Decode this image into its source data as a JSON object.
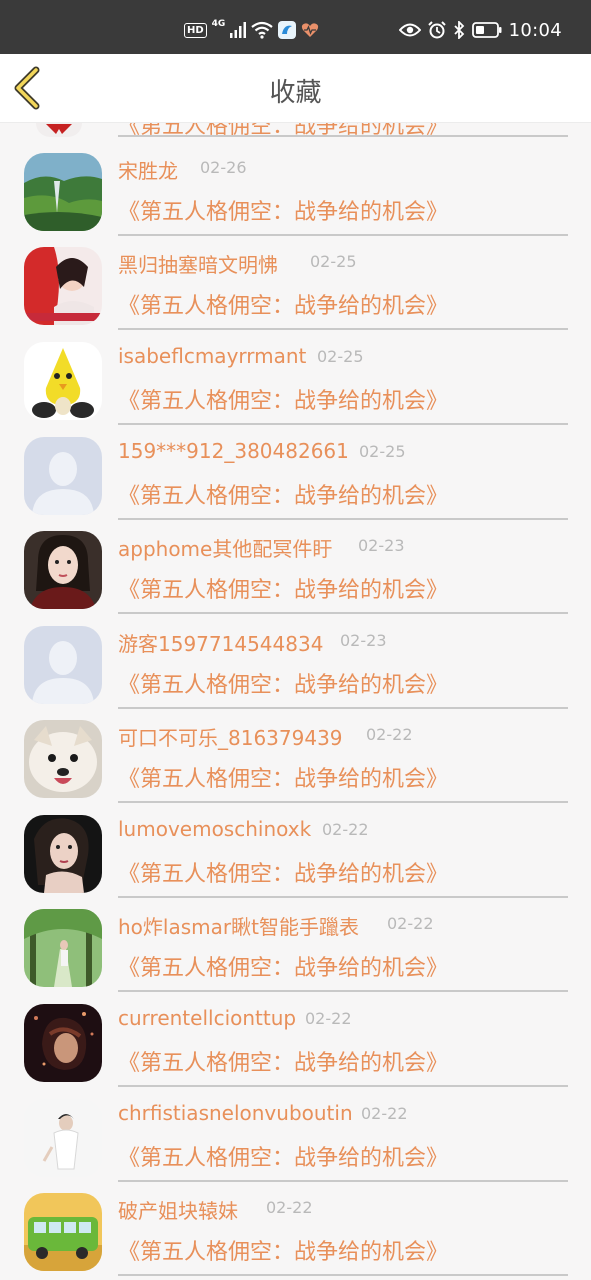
{
  "status_bar": {
    "hd": "HD",
    "network": "4G",
    "time": "10:04"
  },
  "header": {
    "title": "收藏",
    "back_icon": "chevron-left-icon"
  },
  "accent_color": "#e8905a",
  "partial_entry": {
    "book": "《第五人格佣空：战争给的机会》"
  },
  "entries": [
    {
      "name": "宋胜龙",
      "date": "02-26",
      "book": "《第五人格佣空：战争给的机会》",
      "avatar": "landscape-photo"
    },
    {
      "name": "黑归抽塞暗文明怫",
      "date": "02-25",
      "book": "《第五人格佣空：战争给的机会》",
      "avatar": "portrait-red-photo"
    },
    {
      "name": "isabeflcmayrrmant",
      "date": "02-25",
      "book": "《第五人格佣空：战争给的机会》",
      "avatar": "yellow-toy-photo"
    },
    {
      "name": "159***912_380482661",
      "date": "02-25",
      "book": "《第五人格佣空：战争给的机会》",
      "avatar": "default-person"
    },
    {
      "name": "apphome其他配冥件盱",
      "date": "02-23",
      "book": "《第五人格佣空：战争给的机会》",
      "avatar": "portrait-dark-photo"
    },
    {
      "name": "游客1597714544834",
      "date": "02-23",
      "book": "《第五人格佣空：战争给的机会》",
      "avatar": "default-person"
    },
    {
      "name": "可口不可乐_816379439",
      "date": "02-22",
      "book": "《第五人格佣空：战争给的机会》",
      "avatar": "dog-photo"
    },
    {
      "name": "lumovemoschinoxk",
      "date": "02-22",
      "book": "《第五人格佣空：战争给的机会》",
      "avatar": "portrait-dark-photo"
    },
    {
      "name": "ho炸lasmar瞅t智能手躐表",
      "date": "02-22",
      "book": "《第五人格佣空：战争给的机会》",
      "avatar": "forest-path-photo"
    },
    {
      "name": "currentellcionttup",
      "date": "02-22",
      "book": "《第五人格佣空：战争给的机会》",
      "avatar": "rain-portrait-photo"
    },
    {
      "name": "chrfistiasnelonvuboutin",
      "date": "02-22",
      "book": "《第五人格佣空：战争给的机会》",
      "avatar": "white-portrait-photo"
    },
    {
      "name": "破产姐块辕妹",
      "date": "02-22",
      "book": "《第五人格佣空：战争给的机会》",
      "avatar": "green-bus-photo"
    }
  ]
}
